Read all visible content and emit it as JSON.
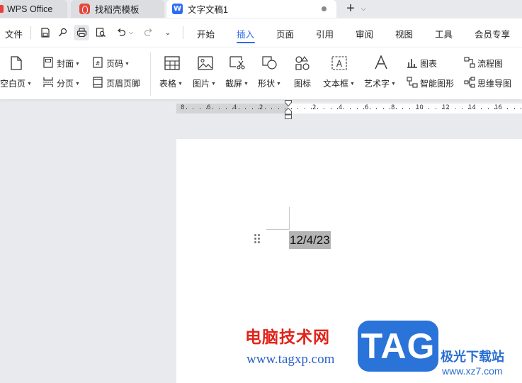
{
  "tabs": [
    {
      "label": "WPS Office"
    },
    {
      "label": "找稻壳模板"
    },
    {
      "label": "文字文稿1",
      "icon_letter": "W"
    }
  ],
  "menubar": {
    "file_label": "文件",
    "items": [
      "开始",
      "插入",
      "页面",
      "引用",
      "审阅",
      "视图",
      "工具",
      "会员专享"
    ],
    "active": "插入"
  },
  "ribbon": {
    "blank_page": "空白页",
    "cover": "封面",
    "page_break": "分页",
    "page_number": "页码",
    "header_footer": "页眉页脚",
    "table": "表格",
    "picture": "图片",
    "screenshot": "截屏",
    "shape": "形状",
    "icon": "图标",
    "textbox": "文本框",
    "wordart": "艺术字",
    "chart": "图表",
    "smart_graphic": "智能图形",
    "flowchart": "流程图",
    "mindmap": "思维导图"
  },
  "ruler": {
    "left_numbers": [
      "8",
      "6",
      "4",
      "2"
    ],
    "right_numbers": [
      "2",
      "4",
      "6",
      "8",
      "10",
      "12",
      "14",
      "16"
    ]
  },
  "document": {
    "selected_text": "12/4/23"
  },
  "watermark": {
    "title": "电脑技术网",
    "url": "www.tagxp.com",
    "logo": "TAG",
    "brand": "极光下载站",
    "site": "www.xz7.com"
  },
  "colors": {
    "accent": "#2d6cf0",
    "selection": "#b4b4b4",
    "watermark_red": "#e2231a",
    "watermark_blue": "#2a73d9"
  }
}
